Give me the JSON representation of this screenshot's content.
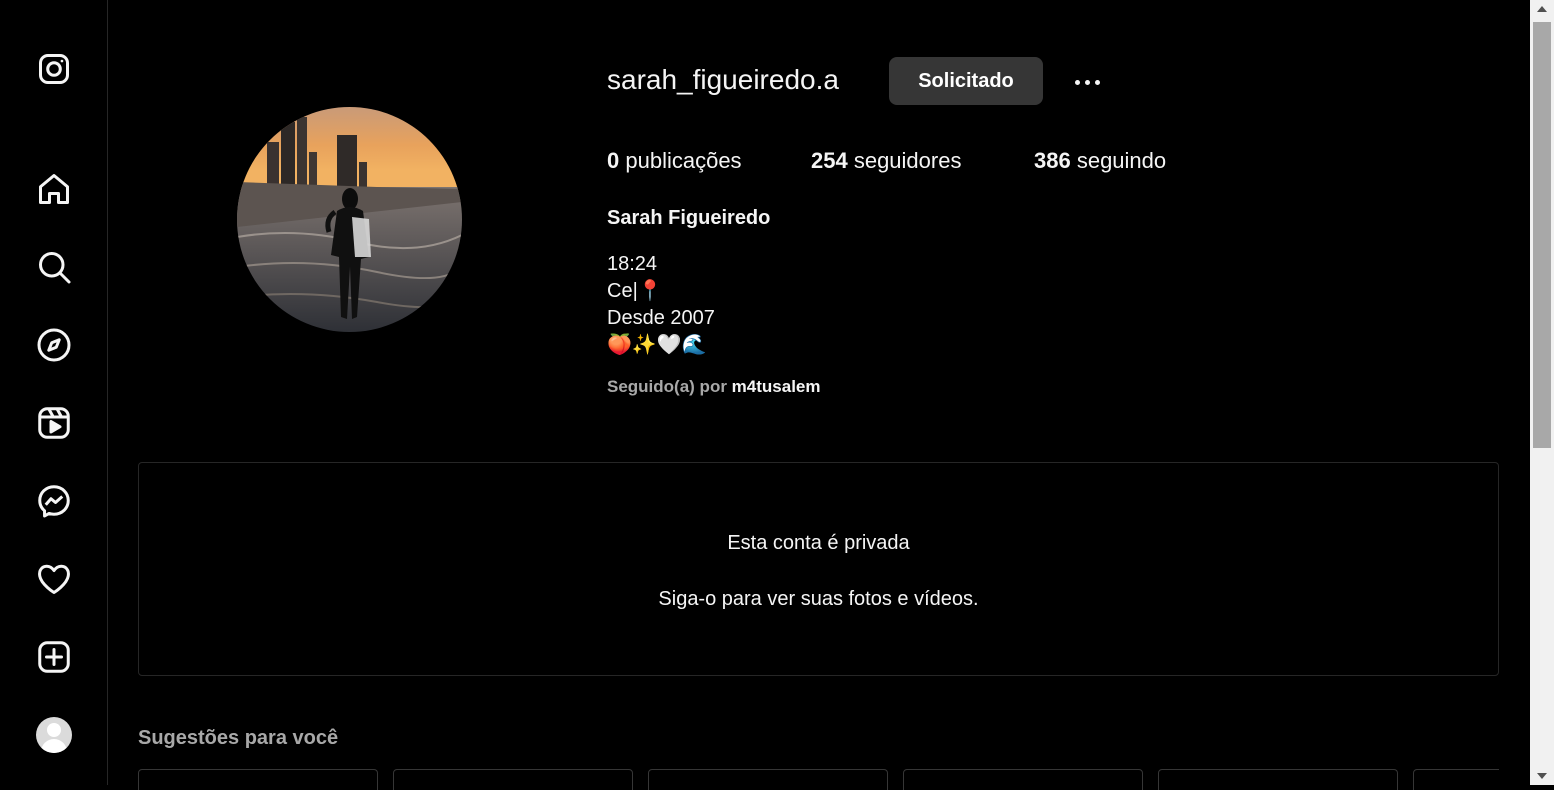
{
  "sidebar": {
    "icons": [
      "instagram-logo-icon",
      "home-icon",
      "search-icon",
      "explore-compass-icon",
      "reels-icon",
      "messenger-icon",
      "heart-icon",
      "create-plus-icon",
      "profile-avatar"
    ]
  },
  "profile": {
    "username": "sarah_figueiredo.a",
    "request_button": "Solicitado",
    "stats": {
      "posts_count": "0",
      "posts_label": " publicações",
      "followers_count": "254",
      "followers_label": " seguidores",
      "following_count": "386",
      "following_label": " seguindo"
    },
    "full_name": "Sarah Figueiredo",
    "bio": {
      "line1": "18:24",
      "line2": "Ce|📍",
      "line3": "Desde 2007",
      "line4": "🍑✨🤍🌊"
    },
    "followed_by_prefix": "Seguido(a) por ",
    "followed_by_user": "m4tusalem"
  },
  "private_notice": {
    "title": "Esta conta é privada",
    "subtitle": "Siga-o para ver suas fotos e vídeos."
  },
  "suggestions": {
    "title": "Sugestões para você"
  },
  "colors": {
    "background": "#000000",
    "text": "#f5f5f5",
    "secondary_text": "#a8a8a8",
    "button_bg": "#363636",
    "border": "#262626"
  }
}
